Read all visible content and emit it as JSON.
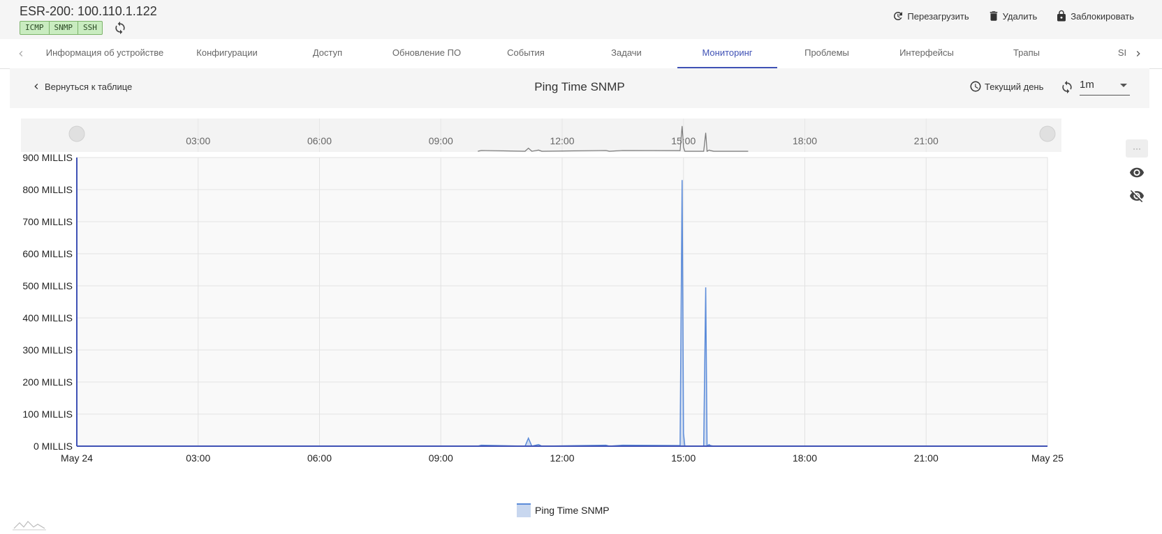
{
  "device": {
    "title": "ESR-200: 100.110.1.122",
    "protocols": [
      "ICMP",
      "SNMP",
      "SSH"
    ]
  },
  "actions": {
    "reboot": "Перезагрузить",
    "delete": "Удалить",
    "lock": "Заблокировать"
  },
  "tabs": [
    {
      "label": "Информация об устройстве"
    },
    {
      "label": "Конфигурации"
    },
    {
      "label": "Доступ"
    },
    {
      "label": "Обновление ПО"
    },
    {
      "label": "События"
    },
    {
      "label": "Задачи"
    },
    {
      "label": "Мониторинг",
      "active": true
    },
    {
      "label": "Проблемы"
    },
    {
      "label": "Интерфейсы"
    },
    {
      "label": "Трапы"
    },
    {
      "label": "SI"
    }
  ],
  "subbar": {
    "back": "Вернуться к таблице",
    "title": "Ping Time SNMP",
    "period": "Текущий день",
    "interval": "1m"
  },
  "colors": {
    "accent": "#3f51b5",
    "series": "#5b8bd9",
    "navigator": "#777777"
  },
  "chart_data": {
    "type": "area",
    "series": [
      {
        "name": "Ping Time SNMP",
        "x": [
          "00:00",
          "09:55",
          "10:00",
          "11:05",
          "11:10",
          "11:15",
          "11:25",
          "11:30",
          "13:05",
          "13:10",
          "13:30",
          "14:55",
          "14:58",
          "15:00",
          "15:02",
          "15:05",
          "15:30",
          "15:33",
          "15:35",
          "15:38",
          "15:40",
          "15:45",
          "24:00"
        ],
        "values": [
          0,
          0,
          3,
          0,
          25,
          0,
          5,
          0,
          3,
          0,
          3,
          2,
          830,
          40,
          0,
          0,
          0,
          495,
          0,
          5,
          2,
          0,
          0
        ]
      }
    ],
    "y_tick_labels": [
      "0 MILLIS",
      "100 MILLIS",
      "200 MILLIS",
      "300 MILLIS",
      "400 MILLIS",
      "500 MILLIS",
      "600 MILLIS",
      "700 MILLIS",
      "800 MILLIS",
      "900 MILLIS"
    ],
    "x_tick_labels": [
      "May 24",
      "03:00",
      "06:00",
      "09:00",
      "12:00",
      "15:00",
      "18:00",
      "21:00",
      "May 25"
    ],
    "navigator_ticks": [
      "03:00",
      "06:00",
      "09:00",
      "12:00",
      "15:00",
      "18:00",
      "21:00"
    ],
    "ylim": [
      0,
      900
    ],
    "xlim_hours": [
      0,
      24
    ],
    "grid": true,
    "legend": "bottom-center"
  }
}
